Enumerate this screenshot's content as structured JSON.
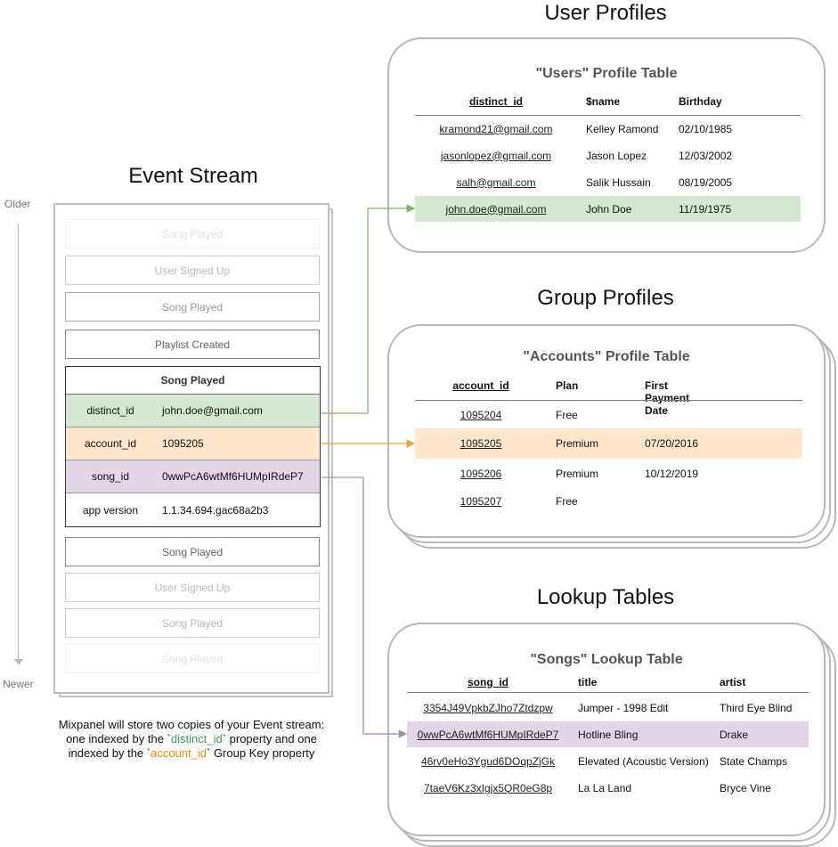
{
  "event_stream": {
    "title": "Event Stream",
    "timeline": {
      "older_label": "Older",
      "newer_label": "Newer"
    },
    "events_before": [
      {
        "name": "Song Played",
        "style": "faint"
      },
      {
        "name": "User Signed Up",
        "style": "light"
      },
      {
        "name": "Song Played",
        "style": "mid"
      },
      {
        "name": "Playlist Created",
        "style": "dark"
      }
    ],
    "selected_event": {
      "name": "Song Played",
      "properties": [
        {
          "key": "distinct_id",
          "value": "john.doe@gmail.com",
          "highlight": "#d5e8d4"
        },
        {
          "key": "account_id",
          "value": "1095205",
          "highlight": "#ffe6cc"
        },
        {
          "key": "song_id",
          "value": "0wwPcA6wtMf6HUMpIRdeP7",
          "highlight": "#e1d5e7"
        },
        {
          "key": "app version",
          "value": "1.1.34.694.gac68a2b3",
          "highlight": "#ffffff"
        }
      ]
    },
    "events_after": [
      {
        "name": "Song Played",
        "style": "dark"
      },
      {
        "name": "User Signed Up",
        "style": "light"
      },
      {
        "name": "Song Played",
        "style": "light"
      },
      {
        "name": "Song Played",
        "style": "faint"
      }
    ],
    "caption": {
      "line1": "Mixpanel will store two copies of your Event stream:",
      "line2_pre": "one indexed by the `",
      "line2_key": "distinct_id",
      "line2_post": "` property and one",
      "line3_pre": "indexed by the `",
      "line3_key": "account_id",
      "line3_post": "` Group Key property"
    }
  },
  "user_profiles": {
    "title": "User Profiles",
    "table_title": "\"Users\" Profile Table",
    "columns": [
      "distinct_id",
      "$name",
      "Birthday"
    ],
    "rows": [
      [
        "kramond21@gmail.com",
        "Kelley Ramond",
        "02/10/1985"
      ],
      [
        "jasonlopez@gmail.com",
        "Jason Lopez",
        "12/03/2002"
      ],
      [
        "salh@gmail.com",
        "Salik Hussain",
        "08/19/2005"
      ],
      [
        "john.doe@gmail.com",
        "John Doe",
        "11/19/1975"
      ]
    ],
    "highlighted_row": 3
  },
  "group_profiles": {
    "title": "Group Profiles",
    "table_title": "\"Accounts\" Profile Table",
    "columns": [
      "account_id",
      "Plan",
      "First Payment Date"
    ],
    "rows": [
      [
        "1095204",
        "Free",
        ""
      ],
      [
        "1095205",
        "Premium",
        "07/20/2016"
      ],
      [
        "1095206",
        "Premium",
        "10/12/2019"
      ],
      [
        "1095207",
        "Free",
        ""
      ]
    ],
    "highlighted_row": 1
  },
  "lookup_tables": {
    "title": "Lookup Tables",
    "table_title": "\"Songs\" Lookup Table",
    "columns": [
      "song_id",
      "title",
      "artist"
    ],
    "rows": [
      [
        "3354J49VpkbZJho7Ztdzpw",
        "Jumper - 1998 Edit",
        "Third Eye Blind"
      ],
      [
        "0wwPcA6wtMf6HUMpIRdeP7",
        "Hotline Bling",
        "Drake"
      ],
      [
        "46rv0eHo3Ygud6DOqpZjGk",
        "Elevated (Acoustic Version)",
        "State Champs"
      ],
      [
        "7taeV6Kz3xIgjx5QR0eG8p",
        "La La Land",
        "Bryce Vine"
      ]
    ],
    "highlighted_row": 1
  },
  "colors": {
    "distinct_id_link": "#82b366",
    "account_id_link": "#f0a030",
    "song_id_link": "#a680b8",
    "green_highlight": "#d5e8d4",
    "orange_highlight": "#ffe6cc",
    "purple_highlight": "#e1d5e7"
  }
}
